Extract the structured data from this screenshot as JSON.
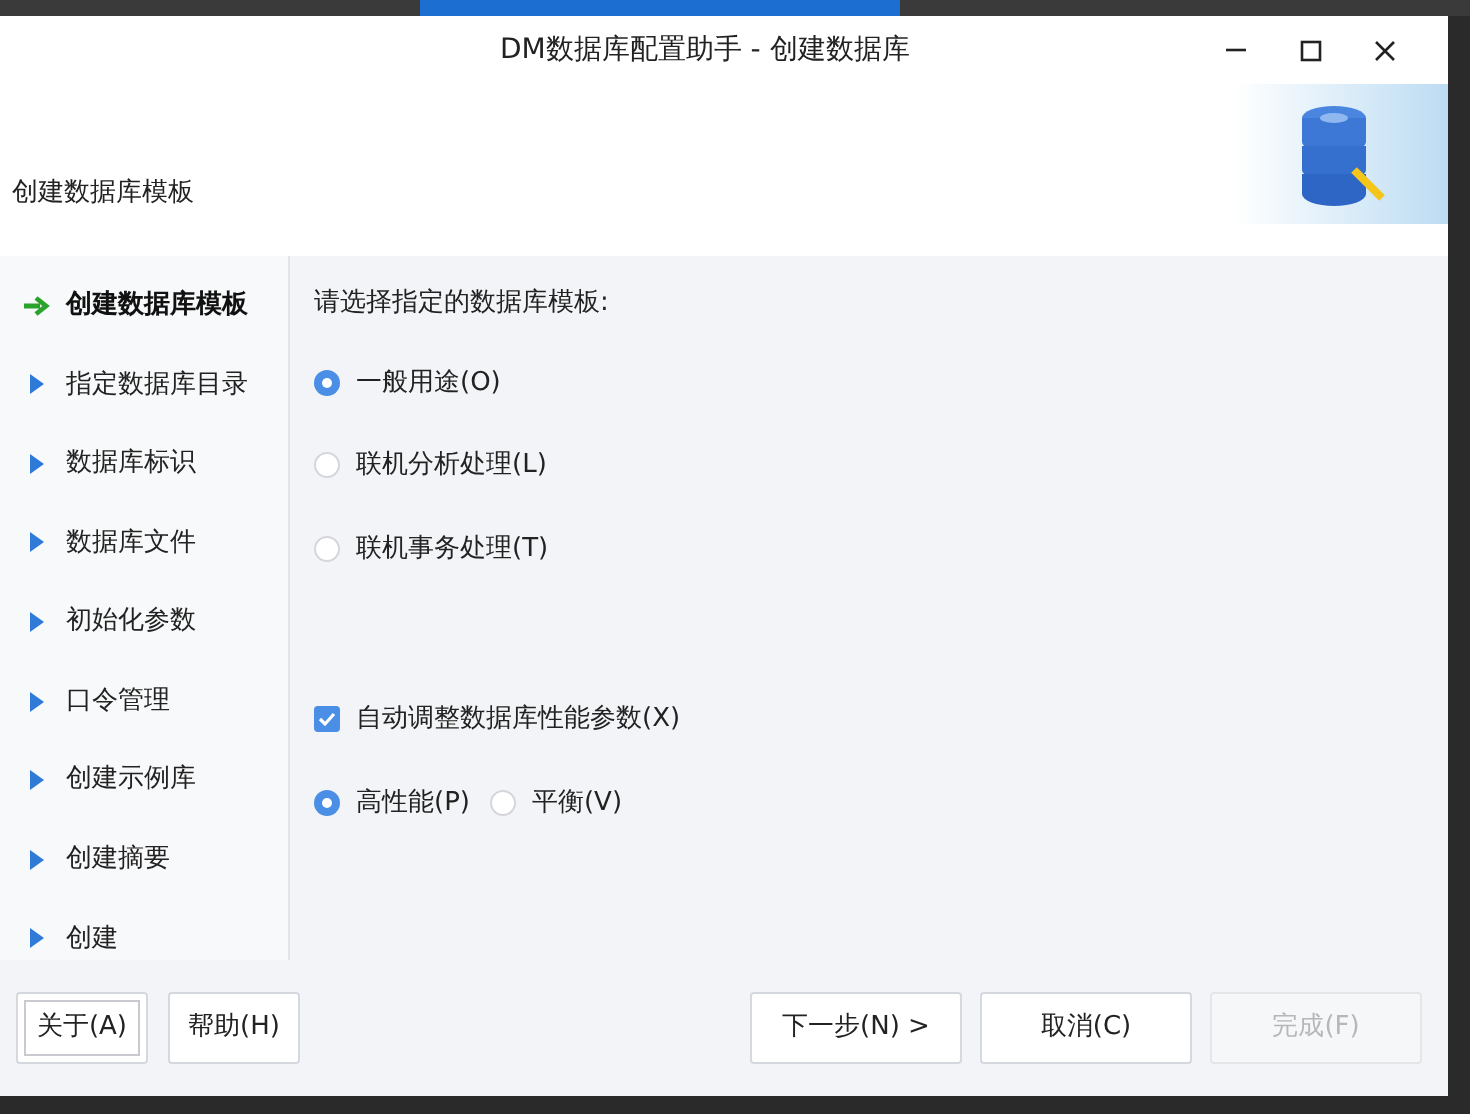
{
  "window": {
    "title": "DM数据库配置助手 - 创建数据库"
  },
  "header": {
    "subtitle": "创建数据库模板"
  },
  "steps": [
    {
      "label": "创建数据库模板",
      "selected": true
    },
    {
      "label": "指定数据库目录",
      "selected": false
    },
    {
      "label": "数据库标识",
      "selected": false
    },
    {
      "label": "数据库文件",
      "selected": false
    },
    {
      "label": "初始化参数",
      "selected": false
    },
    {
      "label": "口令管理",
      "selected": false
    },
    {
      "label": "创建示例库",
      "selected": false
    },
    {
      "label": "创建摘要",
      "selected": false
    },
    {
      "label": "创建",
      "selected": false
    }
  ],
  "content": {
    "prompt": "请选择指定的数据库模板:",
    "templates": [
      {
        "label": "一般用途(O)",
        "selected": true
      },
      {
        "label": "联机分析处理(L)",
        "selected": false
      },
      {
        "label": "联机事务处理(T)",
        "selected": false
      }
    ],
    "auto_tune": {
      "label": "自动调整数据库性能参数(X)",
      "checked": true
    },
    "modes": [
      {
        "label": "高性能(P)",
        "selected": true
      },
      {
        "label": "平衡(V)",
        "selected": false
      }
    ]
  },
  "buttons_left": [
    {
      "label": "关于(A)",
      "disabled": false,
      "focused": true
    },
    {
      "label": "帮助(H)",
      "disabled": false,
      "focused": false
    }
  ],
  "buttons_right": [
    {
      "label": "下一步(N) >",
      "disabled": false,
      "focused": false
    },
    {
      "label": "取消(C)",
      "disabled": false,
      "focused": false
    },
    {
      "label": "完成(F)",
      "disabled": true,
      "focused": false
    }
  ]
}
